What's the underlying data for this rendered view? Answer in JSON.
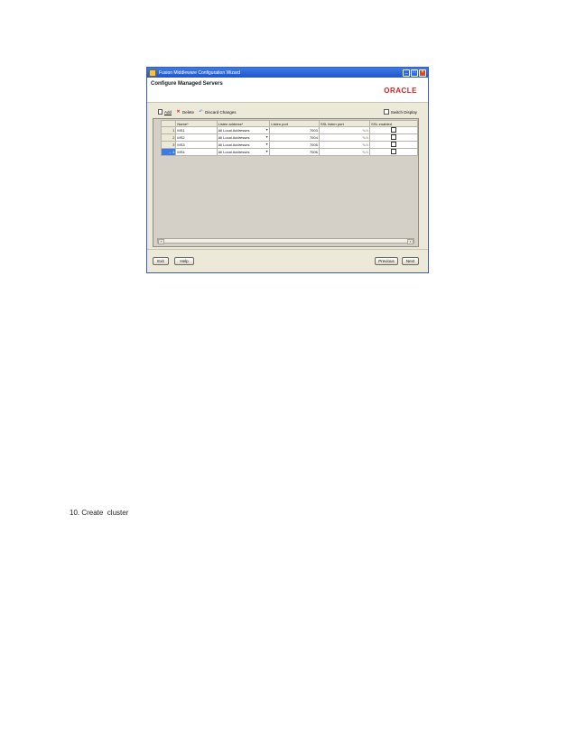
{
  "window": {
    "title": "Fusion Middleware Configuration Wizard",
    "controls": [
      "_",
      "□",
      "×"
    ]
  },
  "header": {
    "page_title": "Configure Managed Servers",
    "logo_text": "ORACLE"
  },
  "toolbar": {
    "add_label": "Add",
    "delete_label": "Delete",
    "discard_label": "Discard Changes",
    "switch_label": "Switch Display"
  },
  "table": {
    "columns": [
      "Name*",
      "Listen address*",
      "Listen port",
      "SSL listen port",
      "SSL enabled"
    ],
    "rows": [
      {
        "num": "1",
        "name": "MS1",
        "address": "All Local Addresses",
        "port": "7003",
        "ssl_port": "N/A",
        "ssl_enabled": false
      },
      {
        "num": "2",
        "name": "MS2",
        "address": "All Local Addresses",
        "port": "7004",
        "ssl_port": "N/A",
        "ssl_enabled": false
      },
      {
        "num": "3",
        "name": "MS3",
        "address": "All Local Addresses",
        "port": "7005",
        "ssl_port": "N/A",
        "ssl_enabled": false
      },
      {
        "num": "4",
        "name": "MS4",
        "address": "All Local Addresses",
        "port": "7006",
        "ssl_port": "N/A",
        "ssl_enabled": false
      }
    ],
    "current_row_marker": "→"
  },
  "footer": {
    "exit_label": "Exit",
    "help_label": "Help",
    "previous_label": "Previous",
    "next_label": "Next"
  },
  "caption": "10. Create  cluster",
  "colors": {
    "titlebar": "#1f55c8",
    "window_bg": "#ece9d8",
    "logo": "#d21f1f"
  }
}
